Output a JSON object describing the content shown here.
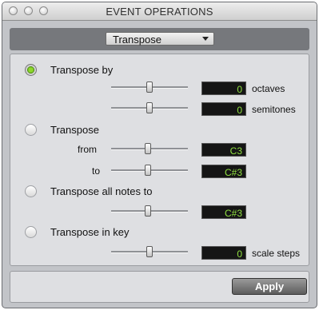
{
  "window": {
    "title": "EVENT OPERATIONS"
  },
  "operation_menu": {
    "selected": "Transpose"
  },
  "options": {
    "transpose_by": {
      "label": "Transpose by",
      "selected": true,
      "octaves": {
        "value": "0",
        "unit": "octaves"
      },
      "semitones": {
        "value": "0",
        "unit": "semitones"
      }
    },
    "transpose_from_to": {
      "label": "Transpose",
      "selected": false,
      "from": {
        "label": "from",
        "value": "C3"
      },
      "to": {
        "label": "to",
        "value": "C#3"
      }
    },
    "transpose_all": {
      "label": "Transpose all notes to",
      "selected": false,
      "value": "C#3"
    },
    "transpose_in_key": {
      "label": "Transpose in key",
      "selected": false,
      "value": "0",
      "unit": "scale steps"
    }
  },
  "footer": {
    "apply_label": "Apply"
  },
  "colors": {
    "value_text": "#90e040",
    "value_bg": "#151515",
    "radio_selected": "#7ccf22"
  }
}
